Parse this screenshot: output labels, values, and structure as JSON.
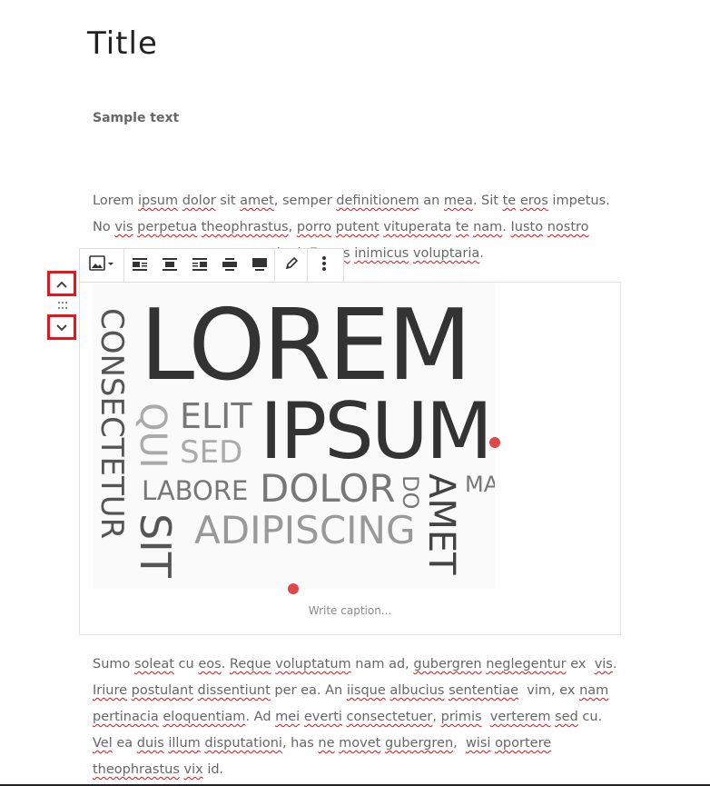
{
  "post": {
    "title": "Title",
    "sample_text": "Sample text"
  },
  "paragraph1": {
    "lines": [
      [
        {
          "t": "Lorem",
          "sq": false
        },
        {
          "t": " "
        },
        {
          "t": "ipsum",
          "sq": true
        },
        {
          "t": " "
        },
        {
          "t": "dolor",
          "sq": true
        },
        {
          "t": " sit "
        },
        {
          "t": "amet",
          "sq": true
        },
        {
          "t": ", semper "
        },
        {
          "t": "definitionem",
          "sq": true
        },
        {
          "t": " an "
        },
        {
          "t": "mea",
          "sq": true
        },
        {
          "t": ". Sit "
        },
        {
          "t": "te",
          "sq": true
        },
        {
          "t": " "
        },
        {
          "t": "eros",
          "sq": true
        },
        {
          "t": " impetus."
        }
      ],
      [
        {
          "t": "No "
        },
        {
          "t": "vis",
          "sq": true
        },
        {
          "t": " "
        },
        {
          "t": "perpetua",
          "sq": true
        },
        {
          "t": " "
        },
        {
          "t": "theophrastus",
          "sq": true
        },
        {
          "t": ", "
        },
        {
          "t": "porro",
          "sq": true
        },
        {
          "t": " "
        },
        {
          "t": "putent",
          "sq": true
        },
        {
          "t": " "
        },
        {
          "t": "vituperata",
          "sq": true
        },
        {
          "t": " "
        },
        {
          "t": "te",
          "sq": true
        },
        {
          "t": " "
        },
        {
          "t": "nam",
          "sq": true
        },
        {
          "t": ". "
        },
        {
          "t": "Iusto",
          "sq": true
        },
        {
          "t": " "
        },
        {
          "t": "nostro",
          "sq": true
        }
      ],
      [
        {
          "t": "                                       "
        },
        {
          "t": "mei",
          "sq": true
        },
        {
          "t": " ad. "
        },
        {
          "t": "Et",
          "sq": true
        },
        {
          "t": " "
        },
        {
          "t": "eos",
          "sq": true
        },
        {
          "t": " "
        },
        {
          "t": "inimicus",
          "sq": true
        },
        {
          "t": " "
        },
        {
          "t": "voluptaria",
          "sq": true
        },
        {
          "t": "."
        }
      ]
    ]
  },
  "paragraph2": {
    "lines": [
      [
        {
          "t": "Sumo "
        },
        {
          "t": "soleat",
          "sq": true
        },
        {
          "t": " cu "
        },
        {
          "t": "eos",
          "sq": true
        },
        {
          "t": ". "
        },
        {
          "t": "Reque",
          "sq": true
        },
        {
          "t": " "
        },
        {
          "t": "voluptatum",
          "sq": true
        },
        {
          "t": " nam ad, "
        },
        {
          "t": "gubergren",
          "sq": true
        },
        {
          "t": " "
        },
        {
          "t": "neglegentur",
          "sq": true
        },
        {
          "t": " ex  "
        },
        {
          "t": "vis",
          "sq": true
        },
        {
          "t": "."
        }
      ],
      [
        {
          "t": "Iriure",
          "sq": true
        },
        {
          "t": " "
        },
        {
          "t": "postulant",
          "sq": true
        },
        {
          "t": " "
        },
        {
          "t": "dissentiunt",
          "sq": true
        },
        {
          "t": " per ea. An "
        },
        {
          "t": "iisque",
          "sq": true
        },
        {
          "t": " "
        },
        {
          "t": "albucius",
          "sq": true
        },
        {
          "t": " "
        },
        {
          "t": "sententiae",
          "sq": true
        },
        {
          "t": "  vim, ex "
        },
        {
          "t": "nam",
          "sq": true
        }
      ],
      [
        {
          "t": "pertinacia",
          "sq": true
        },
        {
          "t": " "
        },
        {
          "t": "eloquentiam",
          "sq": true
        },
        {
          "t": ". Ad "
        },
        {
          "t": "mei",
          "sq": true
        },
        {
          "t": " "
        },
        {
          "t": "everti",
          "sq": true
        },
        {
          "t": " "
        },
        {
          "t": "consectetuer",
          "sq": true
        },
        {
          "t": ", "
        },
        {
          "t": "primis",
          "sq": true
        },
        {
          "t": "  "
        },
        {
          "t": "verterem",
          "sq": true
        },
        {
          "t": " "
        },
        {
          "t": "sed",
          "sq": true
        },
        {
          "t": " cu."
        }
      ],
      [
        {
          "t": "Vel",
          "sq": true
        },
        {
          "t": " ea "
        },
        {
          "t": "duis",
          "sq": true
        },
        {
          "t": " "
        },
        {
          "t": "illum",
          "sq": true
        },
        {
          "t": " "
        },
        {
          "t": "disputationi",
          "sq": true
        },
        {
          "t": ", has "
        },
        {
          "t": "ne",
          "sq": true
        },
        {
          "t": " "
        },
        {
          "t": "movet",
          "sq": true
        },
        {
          "t": " "
        },
        {
          "t": "gubergren",
          "sq": true
        },
        {
          "t": ",  "
        },
        {
          "t": "wisi",
          "sq": true
        },
        {
          "t": " "
        },
        {
          "t": "oportere",
          "sq": true
        }
      ],
      [
        {
          "t": "theophrastus",
          "sq": true
        },
        {
          "t": " "
        },
        {
          "t": "vix",
          "sq": true
        },
        {
          "t": " id."
        }
      ]
    ]
  },
  "toolbar": {
    "buttons": [
      {
        "name": "change-block-type-button",
        "icon": "image-icon"
      },
      {
        "name": "align-left-button",
        "icon": "align-left-icon"
      },
      {
        "name": "align-center-button",
        "icon": "align-center-icon"
      },
      {
        "name": "align-right-button",
        "icon": "align-right-icon"
      },
      {
        "name": "wide-width-button",
        "icon": "align-wide-icon"
      },
      {
        "name": "full-width-button",
        "icon": "align-full-icon"
      },
      {
        "name": "edit-image-button",
        "icon": "pencil-icon"
      },
      {
        "name": "more-options-button",
        "icon": "vertical-ellipsis-icon"
      }
    ]
  },
  "movers": {
    "up_icon": "chevron-up-icon",
    "down_icon": "chevron-down-icon",
    "highlight_color": "#e3151f"
  },
  "word_cloud": {
    "words": [
      "LOREM",
      "IPSUM",
      "CONSECTETUR",
      "QUI",
      "ELIT",
      "SED",
      "LABORE",
      "DOLOR",
      "DO",
      "AMET",
      "MA",
      "SIT",
      "ADIPISCING"
    ]
  },
  "image_block": {
    "caption_placeholder": "Write caption...",
    "resize_handle_color": "#e04848"
  }
}
